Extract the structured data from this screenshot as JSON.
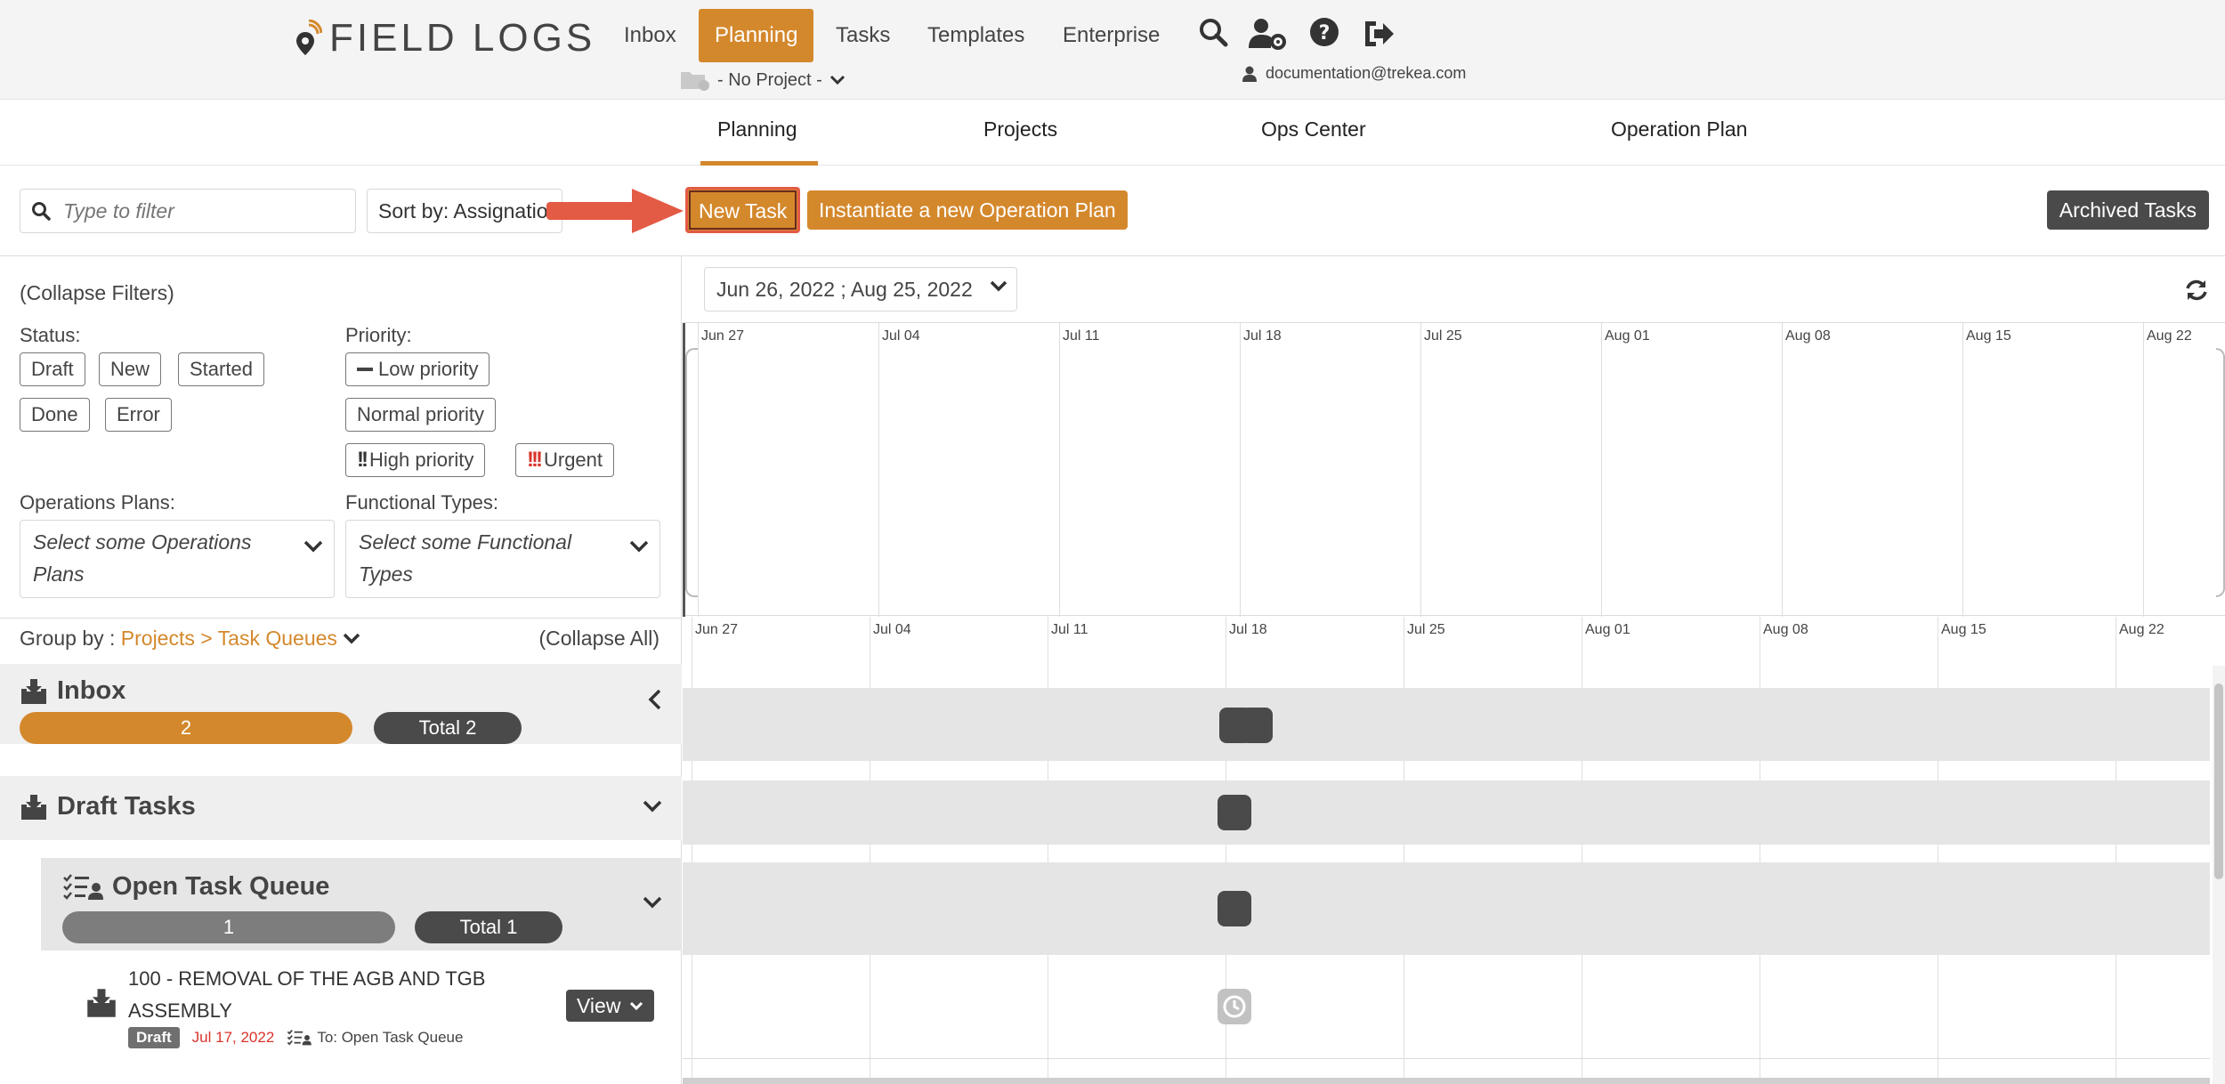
{
  "brand": {
    "logo_text": "FIELD LOGS"
  },
  "nav": {
    "items": [
      {
        "label": "Inbox"
      },
      {
        "label": "Planning"
      },
      {
        "label": "Tasks"
      },
      {
        "label": "Templates"
      },
      {
        "label": "Enterprise"
      }
    ],
    "active": "Planning",
    "project_select": "- No Project -",
    "user_email": "documentation@trekea.com",
    "icons": [
      "search-icon",
      "user-settings-icon",
      "help-icon",
      "logout-icon"
    ]
  },
  "subtabs": [
    {
      "label": "Planning"
    },
    {
      "label": "Projects"
    },
    {
      "label": "Ops Center"
    },
    {
      "label": "Operation Plan"
    }
  ],
  "toolbar": {
    "filter_placeholder": "Type to filter",
    "sort_label": "Sort by: Assignation",
    "new_task": "New Task",
    "instantiate": "Instantiate a new Operation Plan",
    "archived": "Archived Tasks"
  },
  "filters": {
    "collapse_label": "(Collapse Filters)",
    "status_label": "Status:",
    "status_options": [
      "Draft",
      "New",
      "Started",
      "Done",
      "Error"
    ],
    "priority_label": "Priority:",
    "priority_options": [
      "Low priority",
      "Normal priority",
      "High priority",
      "Urgent"
    ],
    "ops_plans_label": "Operations Plans:",
    "ops_plans_placeholder": "Select some Operations Plans",
    "functional_types_label": "Functional Types:",
    "functional_types_placeholder": "Select some Functional Types"
  },
  "grouping": {
    "group_by_label": "Group by :",
    "group_by_value": "Projects > Task Queues",
    "collapse_all": "(Collapse All)"
  },
  "groups": {
    "inbox": {
      "title": "Inbox",
      "count": "2",
      "total": "Total 2"
    },
    "draft": {
      "title": "Draft Tasks"
    },
    "queue": {
      "title": "Open Task Queue",
      "count": "1",
      "total": "Total 1"
    }
  },
  "task": {
    "title": "100 - REMOVAL OF THE AGB AND TGB ASSEMBLY",
    "status": "Draft",
    "date": "Jul 17, 2022",
    "destination": "To: Open Task Queue",
    "view_label": "View"
  },
  "timeline": {
    "date_range": "Jun 26, 2022 ; Aug 25, 2022",
    "ticks": [
      "Jun 27",
      "Jul 04",
      "Jul 11",
      "Jul 18",
      "Jul 25",
      "Aug 01",
      "Aug 08",
      "Aug 15",
      "Aug 22"
    ]
  },
  "colors": {
    "accent": "#d4882c",
    "dark": "#4a4a4a",
    "urgent": "#d9342b",
    "highlight": "#e35a45"
  }
}
